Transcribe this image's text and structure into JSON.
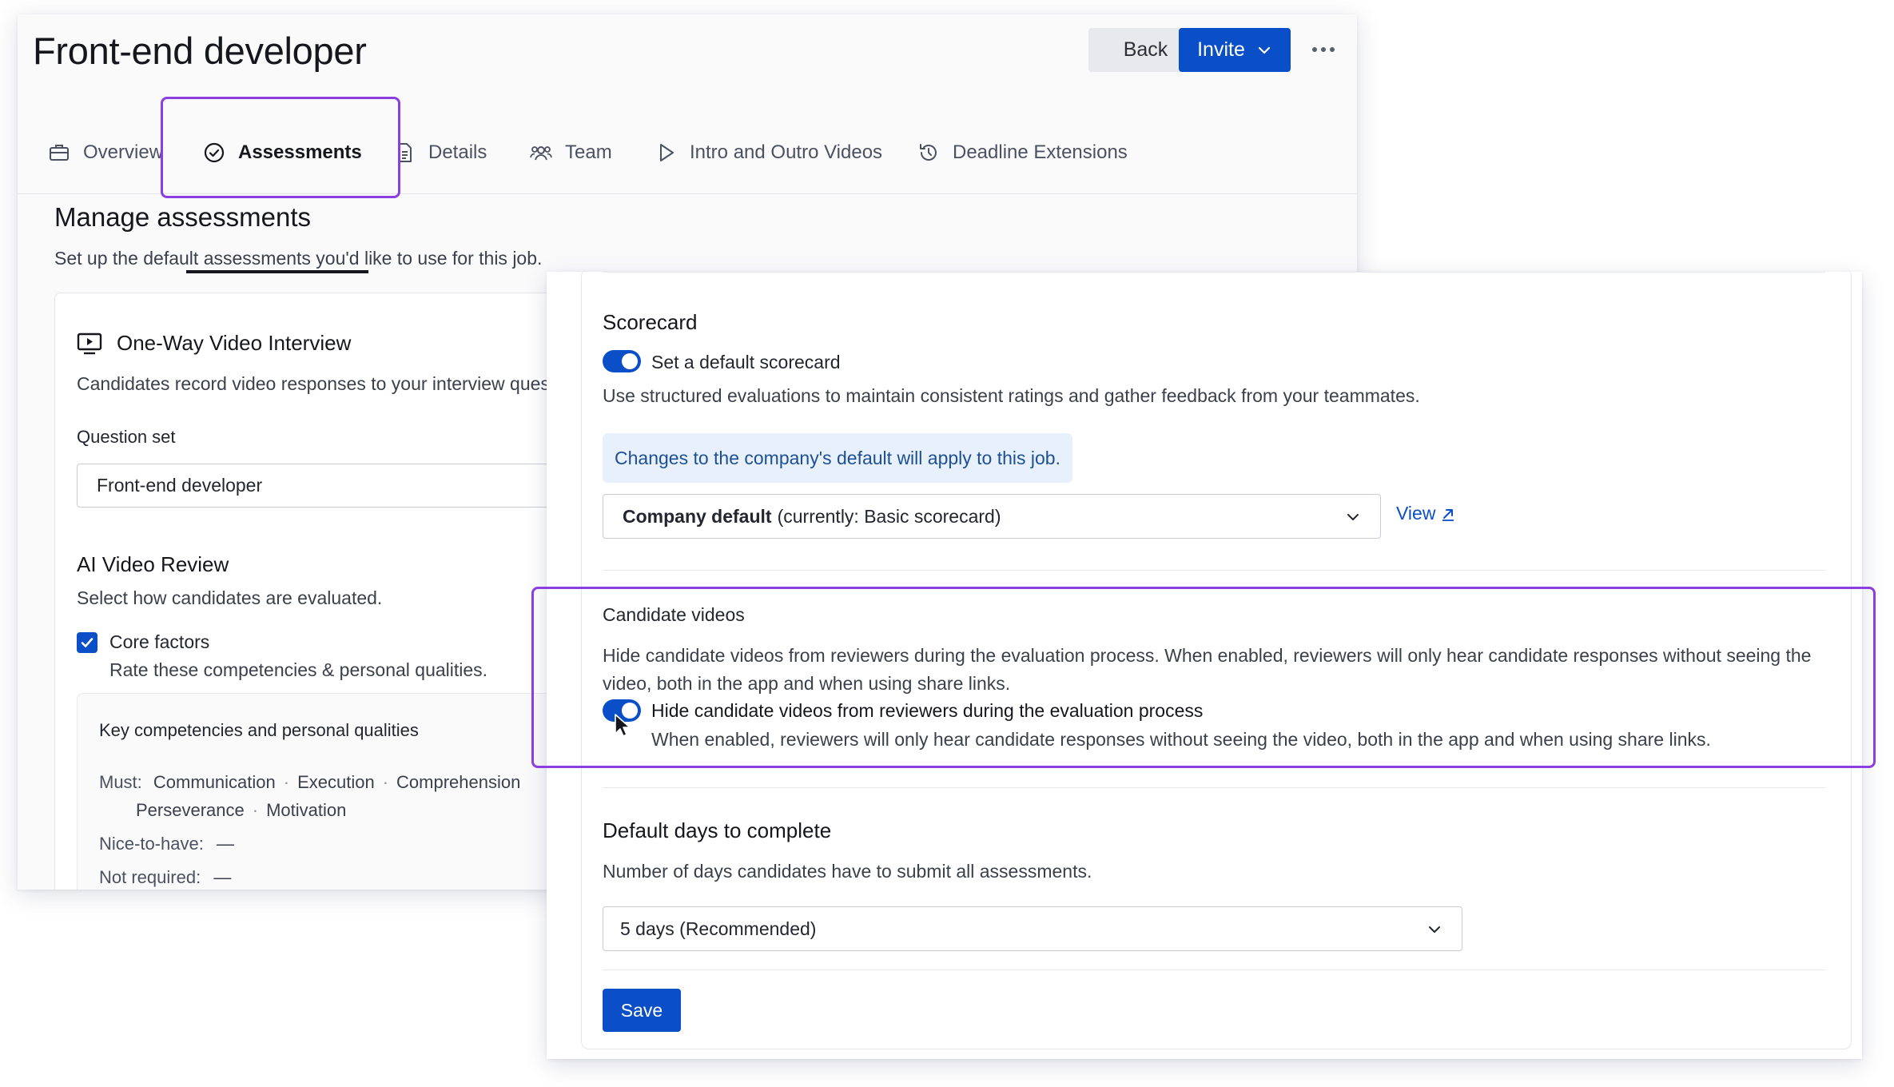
{
  "header": {
    "title": "Front-end developer",
    "back_label": "Back",
    "invite_label": "Invite"
  },
  "tabs": [
    {
      "label": "Overview",
      "icon": "briefcase-icon"
    },
    {
      "label": "Assessments",
      "icon": "check-circle-icon",
      "active": true
    },
    {
      "label": "Details",
      "icon": "document-icon"
    },
    {
      "label": "Team",
      "icon": "team-icon"
    },
    {
      "label": "Intro and Outro Videos",
      "icon": "play-icon"
    },
    {
      "label": "Deadline Extensions",
      "icon": "history-icon"
    }
  ],
  "manage": {
    "title": "Manage assessments",
    "subtitle": "Set up the default assessments you'd like to use for this job."
  },
  "video_interview": {
    "title": "One-Way Video Interview",
    "description": "Candidates record video responses to your interview questions",
    "question_set_label": "Question set",
    "question_set_value": "Front-end developer",
    "ai_title": "AI Video Review",
    "ai_subtitle": "Select how candidates are evaluated.",
    "core_label": "Core factors",
    "core_checked": true,
    "core_sub": "Rate these competencies & personal qualities.",
    "kc_title": "Key competencies and personal qualities",
    "must_label": "Must:",
    "must_items": [
      "Communication",
      "Execution",
      "Comprehension"
    ],
    "must_items_2": [
      "Perseverance",
      "Motivation"
    ],
    "nice_label": "Nice-to-have:",
    "nice_value": "—",
    "not_req_label": "Not required:",
    "not_req_value": "—"
  },
  "scorecard": {
    "title": "Scorecard",
    "toggle_label": "Set a default scorecard",
    "toggle_on": true,
    "description": "Use structured evaluations to maintain consistent ratings and gather feedback from your teammates.",
    "info": "Changes to the company's default will apply to this job.",
    "select_bold": "Company default",
    "select_rest": "(currently: Basic scorecard)",
    "view_label": "View"
  },
  "candidate_videos": {
    "title": "Candidate videos",
    "description": "Hide candidate videos from reviewers during the evaluation process. When enabled, reviewers will only hear candidate responses without seeing the video, both in the app and when using share links.",
    "toggle_label": "Hide candidate videos from reviewers during the evaluation process",
    "toggle_on": true,
    "toggle_sub": "When enabled, reviewers will only hear candidate responses without seeing the video, both in the app and when using share links."
  },
  "default_days": {
    "title": "Default days to complete",
    "subtitle": "Number of days candidates have to submit all assessments.",
    "selected": "5 days (Recommended)",
    "save_label": "Save"
  },
  "colors": {
    "primary": "#0b4fc8",
    "highlight": "#8b3fe0",
    "info_bg": "#e8f1fb"
  }
}
